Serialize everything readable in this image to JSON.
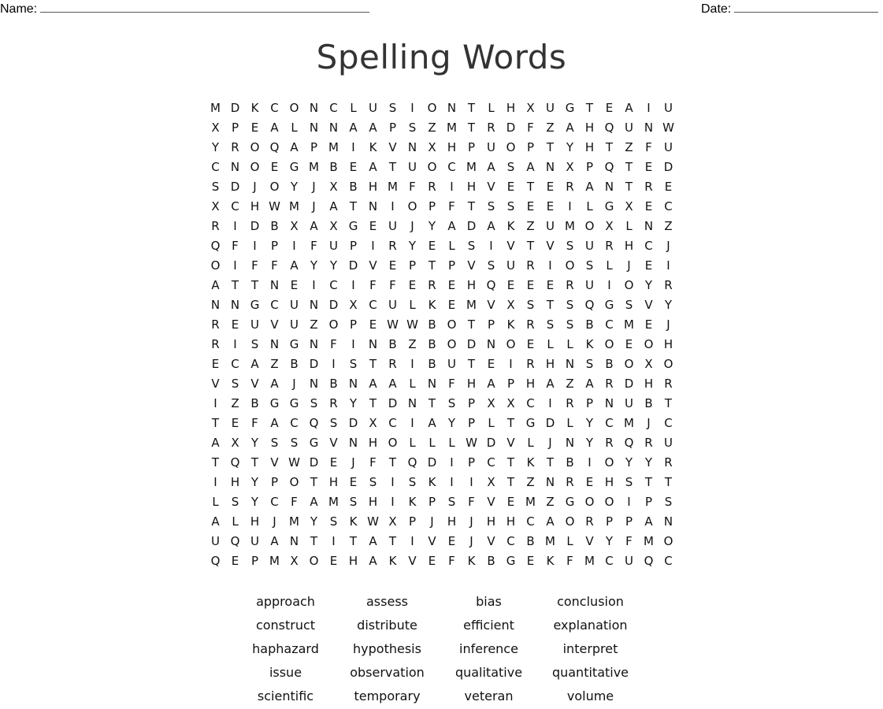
{
  "header": {
    "name_label": "Name:",
    "date_label": "Date:"
  },
  "title": "Spelling Words",
  "grid": {
    "rows": [
      "MDKCONCLUSIONTLHXUGTEAIU",
      "XPEALNNAAPSZMTRDFZAHQUNW",
      "YROQAPMIKVNXHPUOPTYHTZFU",
      "CNOEGMBEATUOCMASANXPQTED",
      "SDJOYJXBHMFRIHVETERANTRE",
      "XCHWMJATNIOPFTSSEEILGXEC",
      "RIDBXAXGEUJYADAKZUMOXLNZ",
      "QFIPIFUPIRYELSIVTVSURHCJ",
      "OIFFAYYDVEPTPVSURIOSLJEI",
      "ATTNEICIFFEREHQEEERUIOYR",
      "NNGCUNDXCULKEMVXSTSQGSVY",
      "REUVUZOPEWWBOTPKRSSBCMEJ",
      "RISNGNFINBZBODNOELLKOEOH",
      "ECAZBDISTRIBUTEIRHNSBOXO",
      "VSVAJNBNAALNFHAPHAZARDHR",
      "IZBGGSRYTDNTSPXXCIRPNUBT",
      "TEFACQSDXCIAYPLTGDLYCMJC",
      "AXYSSGVNHOLLLWDVLJNYRQRU",
      "TQTVWDEJFTQDIPCTKTBIOYYR",
      "IHYPOTHESISKIIXTZNREHSTT",
      "LSYCFAMSHIKPSFVEMZGOOIPS",
      "ALHJMYSKWXPJHJHHCAORPPAN",
      "UQUANTITATIVEJVCBMLVYFMO",
      "QEPMXOEHAKVEFKBGEKFMCUQC"
    ]
  },
  "words": [
    "approach",
    "assess",
    "bias",
    "conclusion",
    "construct",
    "distribute",
    "efficient",
    "explanation",
    "haphazard",
    "hypothesis",
    "inference",
    "interpret",
    "issue",
    "observation",
    "qualitative",
    "quantitative",
    "scientific",
    "temporary",
    "veteran",
    "volume"
  ]
}
